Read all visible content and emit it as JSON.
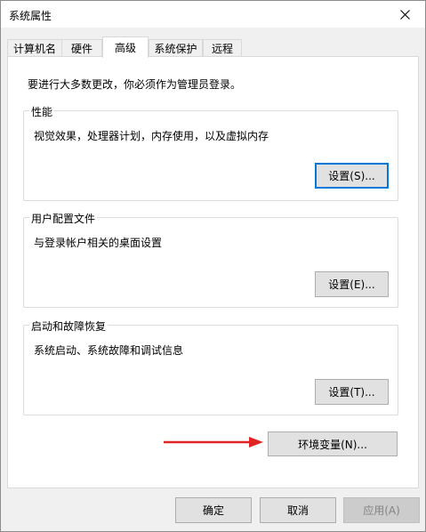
{
  "window": {
    "title": "系统属性"
  },
  "tabs": [
    {
      "label": "计算机名"
    },
    {
      "label": "硬件"
    },
    {
      "label": "高级",
      "active": true
    },
    {
      "label": "系统保护"
    },
    {
      "label": "远程"
    }
  ],
  "panel": {
    "intro": "要进行大多数更改，你必须作为管理员登录。",
    "performance": {
      "title": "性能",
      "description": "视觉效果，处理器计划，内存使用，以及虚拟内存",
      "button": "设置(S)..."
    },
    "user_profiles": {
      "title": "用户配置文件",
      "description": "与登录帐户相关的桌面设置",
      "button": "设置(E)..."
    },
    "startup_recovery": {
      "title": "启动和故障恢复",
      "description": "系统启动、系统故障和调试信息",
      "button": "设置(T)..."
    },
    "env_button": "环境变量(N)..."
  },
  "footer": {
    "ok": "确定",
    "cancel": "取消",
    "apply": "应用(A)"
  },
  "colors": {
    "focus_border": "#0078d7",
    "arrow": "#e02424"
  }
}
